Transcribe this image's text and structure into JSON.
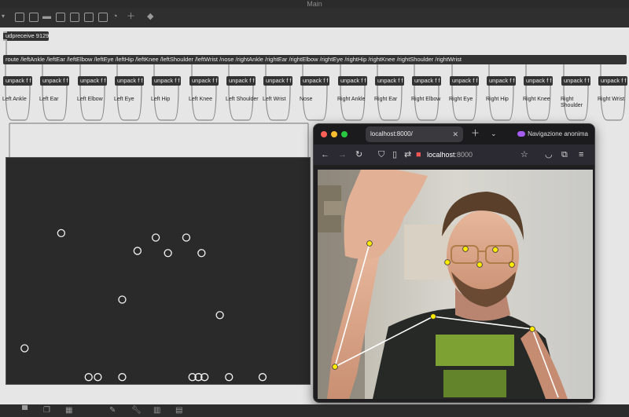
{
  "window": {
    "title": "Main"
  },
  "toolbar": {
    "icons": [
      "new-window-icon",
      "presentation-icon",
      "comment-icon",
      "close-icon",
      "object-icon",
      "inlet-icon",
      "outlet-icon",
      "timer-icon",
      "add-icon",
      "paint-icon"
    ]
  },
  "patch": {
    "udpreceive": "udpreceive 9129",
    "route": "route /leftAnkle /leftEar /leftElbow /leftEye /leftHip /leftKnee /leftShoulder /leftWrist /nose /rightAnkle /rightEar /rightElbow /rightEye /rightHip /rightKnee /rightShoulder /rightWrist",
    "unpack_label": "unpack f f",
    "labels": [
      "Left Ankle",
      "Left Ear",
      "Left Elbow",
      "Left Eye",
      "Left Hip",
      "Left Knee",
      "Left Shoulder",
      "Left Wrist",
      "Nose",
      "Right Ankle",
      "Right Ear",
      "Right Elbow",
      "Right Eye",
      "Right Hip",
      "Right Knee",
      "Right Shoulder",
      "Right Wrist"
    ]
  },
  "lcd_points": [
    [
      0.18,
      0.34
    ],
    [
      0.43,
      0.42
    ],
    [
      0.49,
      0.36
    ],
    [
      0.53,
      0.43
    ],
    [
      0.59,
      0.36
    ],
    [
      0.64,
      0.43
    ],
    [
      0.38,
      0.64
    ],
    [
      0.7,
      0.71
    ],
    [
      0.06,
      0.86
    ],
    [
      0.27,
      0.99
    ],
    [
      0.3,
      0.99
    ],
    [
      0.38,
      0.99
    ],
    [
      0.61,
      0.99
    ],
    [
      0.63,
      0.99
    ],
    [
      0.65,
      0.99
    ],
    [
      0.73,
      0.99
    ],
    [
      0.84,
      0.99
    ]
  ],
  "browser": {
    "tab_title": "localhost:8000/",
    "url_host": "localhost",
    "url_port": ":8000",
    "private_label": "Navigazione anonima"
  },
  "colors": {
    "keypoint": "#ffeb00",
    "skeleton": "#ffffff",
    "traffic_red": "#fe5f57",
    "traffic_yellow": "#febc2e",
    "traffic_green": "#28c840"
  },
  "bottombar": {
    "icons": [
      "chat-icon",
      "layers-icon",
      "grid-icon",
      "debug-icon",
      "wrench-icon",
      "piano-icon",
      "keyboard-icon"
    ]
  }
}
